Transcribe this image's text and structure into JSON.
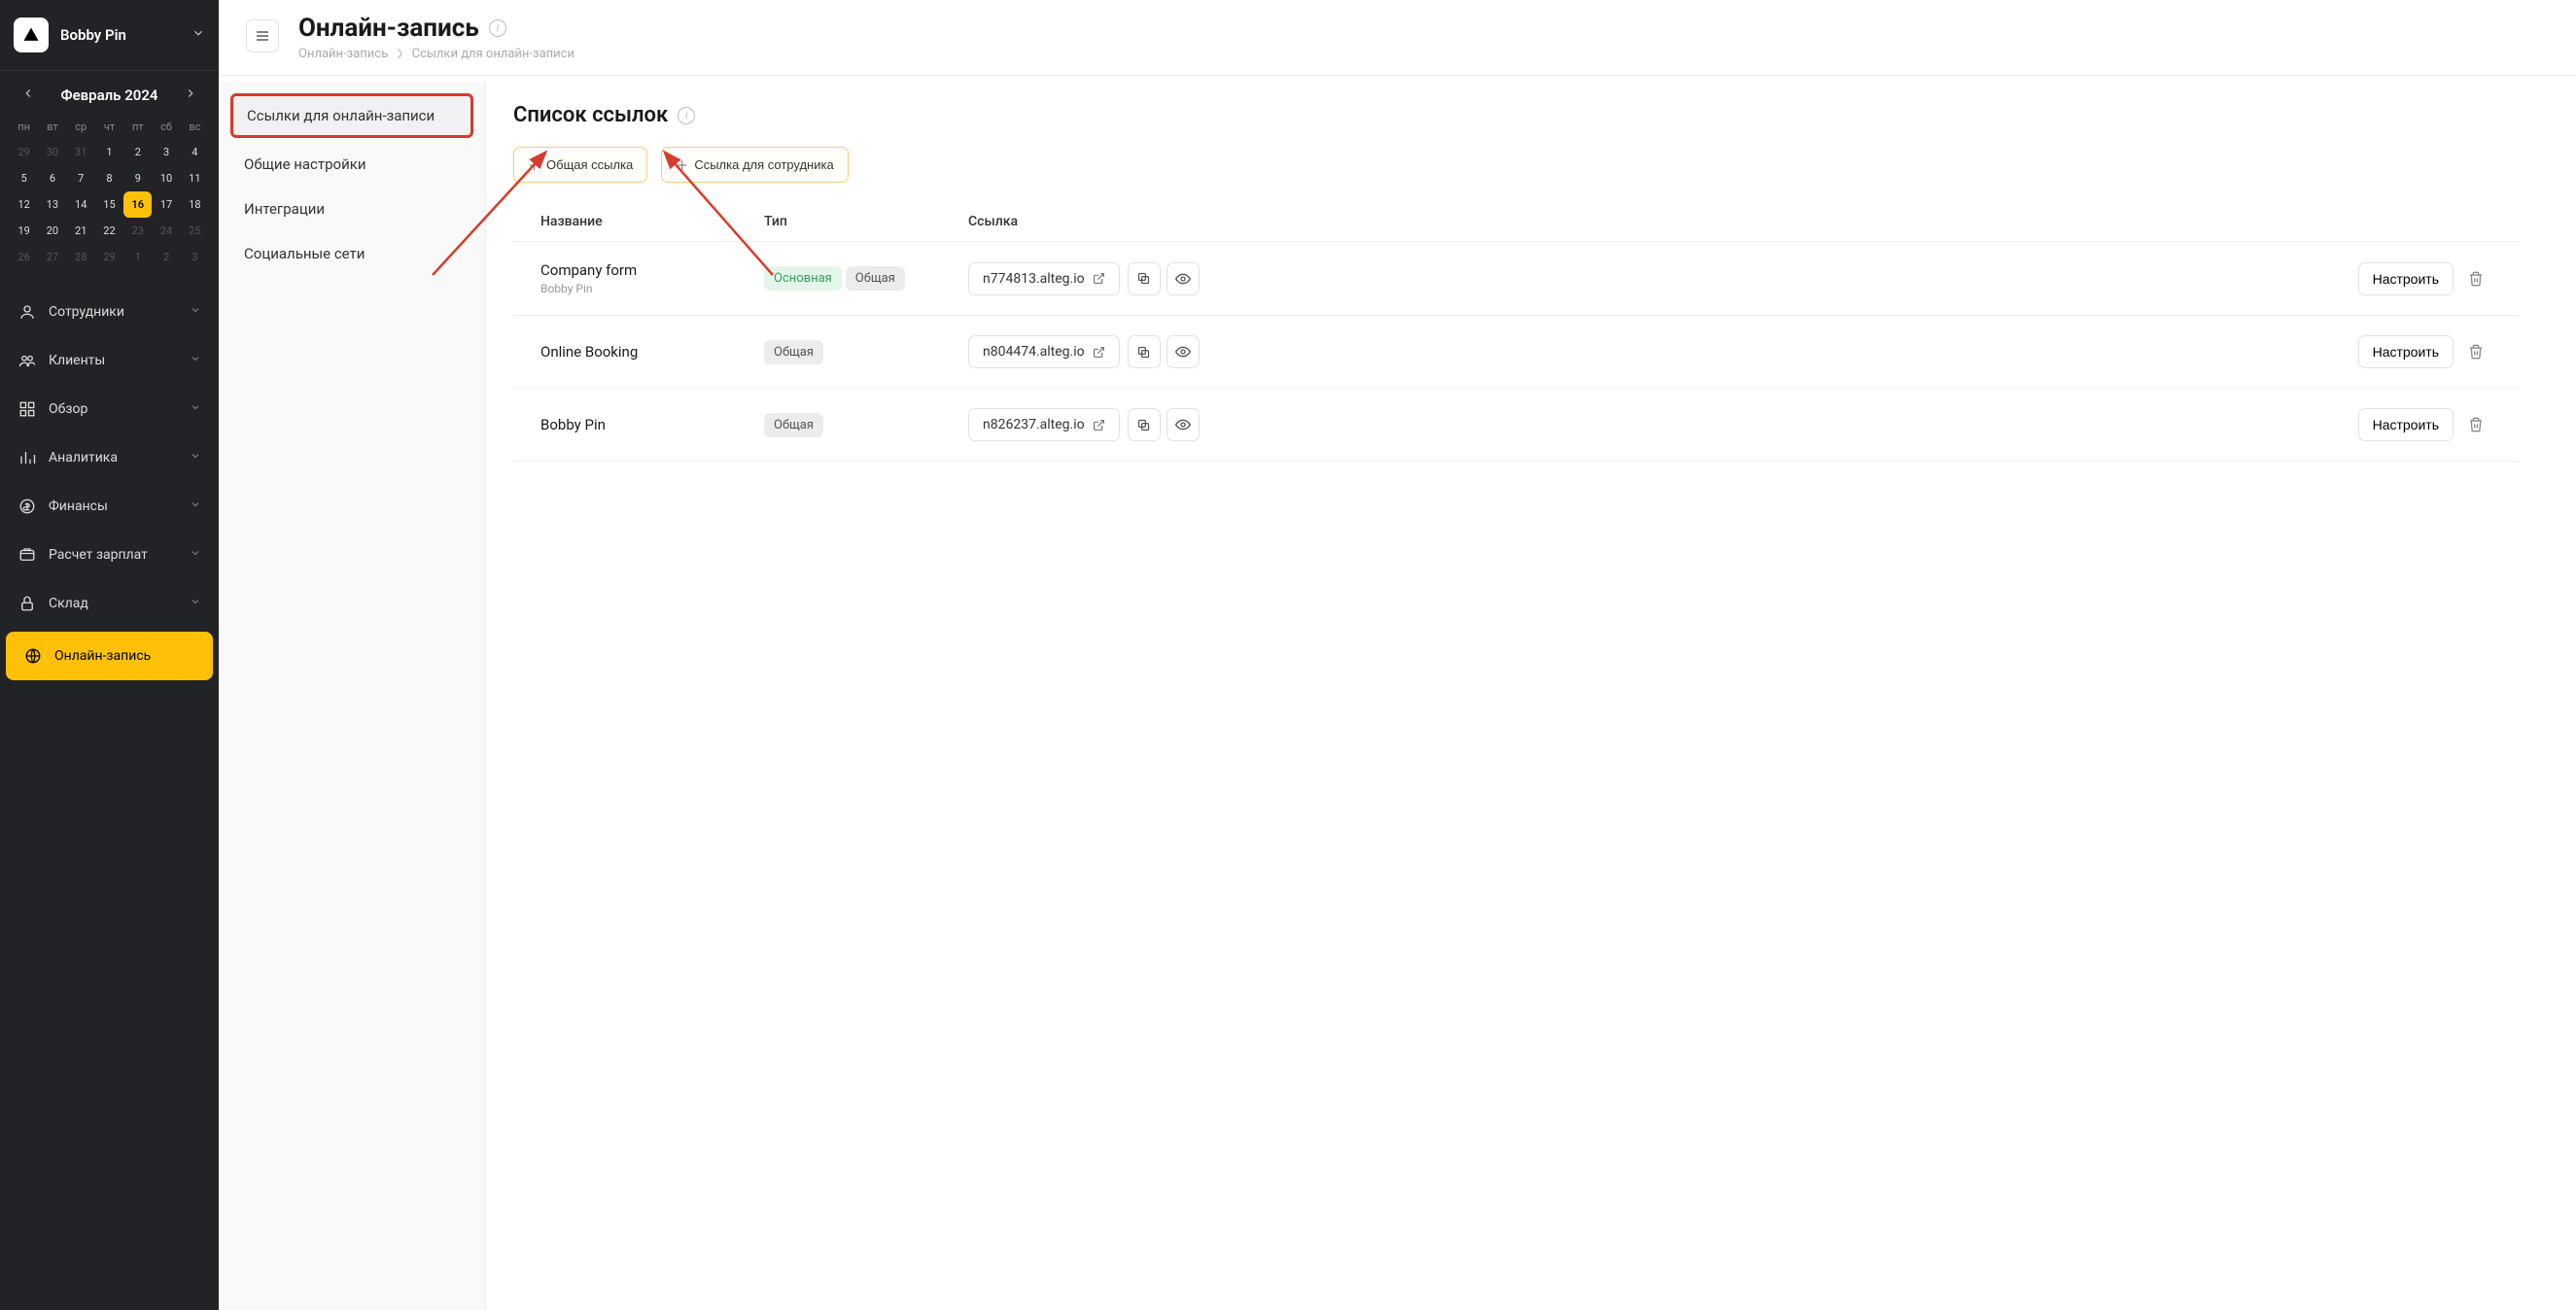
{
  "brand": {
    "name": "Bobby Pin"
  },
  "calendar": {
    "title": "Февраль 2024",
    "dow": [
      "пн",
      "вт",
      "ср",
      "чт",
      "пт",
      "сб",
      "вс"
    ],
    "weeks": [
      [
        {
          "d": "29",
          "f": true
        },
        {
          "d": "30",
          "f": true
        },
        {
          "d": "31",
          "f": true
        },
        {
          "d": "1"
        },
        {
          "d": "2"
        },
        {
          "d": "3"
        },
        {
          "d": "4"
        }
      ],
      [
        {
          "d": "5"
        },
        {
          "d": "6"
        },
        {
          "d": "7"
        },
        {
          "d": "8"
        },
        {
          "d": "9"
        },
        {
          "d": "10"
        },
        {
          "d": "11"
        }
      ],
      [
        {
          "d": "12"
        },
        {
          "d": "13"
        },
        {
          "d": "14"
        },
        {
          "d": "15"
        },
        {
          "d": "16",
          "sel": true
        },
        {
          "d": "17"
        },
        {
          "d": "18"
        }
      ],
      [
        {
          "d": "19"
        },
        {
          "d": "20"
        },
        {
          "d": "21"
        },
        {
          "d": "22"
        },
        {
          "d": "23",
          "f": true
        },
        {
          "d": "24",
          "f": true
        },
        {
          "d": "25",
          "f": true
        }
      ],
      [
        {
          "d": "26",
          "f": true
        },
        {
          "d": "27",
          "f": true
        },
        {
          "d": "28",
          "f": true
        },
        {
          "d": "29",
          "f": true
        },
        {
          "d": "1",
          "f": true
        },
        {
          "d": "2",
          "f": true
        },
        {
          "d": "3",
          "f": true
        }
      ]
    ]
  },
  "nav": {
    "items": [
      {
        "label": "Сотрудники"
      },
      {
        "label": "Клиенты"
      },
      {
        "label": "Обзор"
      },
      {
        "label": "Аналитика"
      },
      {
        "label": "Финансы"
      },
      {
        "label": "Расчет зарплат"
      },
      {
        "label": "Склад"
      },
      {
        "label": "Онлайн-запись",
        "active": true
      }
    ]
  },
  "subnav": {
    "items": [
      {
        "label": "Ссылки для онлайн-записи",
        "selected": true
      },
      {
        "label": "Общие настройки"
      },
      {
        "label": "Интеграции"
      },
      {
        "label": "Социальные сети"
      }
    ]
  },
  "header": {
    "title": "Онлайн-запись",
    "breadcrumb": [
      "Онлайн-запись",
      "Ссылки для онлайн-записи"
    ]
  },
  "section": {
    "title": "Список ссылок",
    "btn1": "Общая ссылка",
    "btn2": "Ссылка для сотрудника"
  },
  "table": {
    "head": {
      "name": "Название",
      "type": "Тип",
      "link": "Ссылка"
    },
    "rows": [
      {
        "name": "Company form",
        "subtitle": "Bobby Pin",
        "tags": [
          {
            "t": "Основная",
            "c": "green"
          },
          {
            "t": "Общая",
            "c": "grey"
          }
        ],
        "url": "n774813.alteg.io",
        "cfg": "Настроить"
      },
      {
        "name": "Online Booking",
        "subtitle": "",
        "tags": [
          {
            "t": "Общая",
            "c": "grey"
          }
        ],
        "url": "n804474.alteg.io",
        "cfg": "Настроить"
      },
      {
        "name": "Bobby Pin",
        "subtitle": "",
        "tags": [
          {
            "t": "Общая",
            "c": "grey"
          }
        ],
        "url": "n826237.alteg.io",
        "cfg": "Настроить"
      }
    ]
  }
}
